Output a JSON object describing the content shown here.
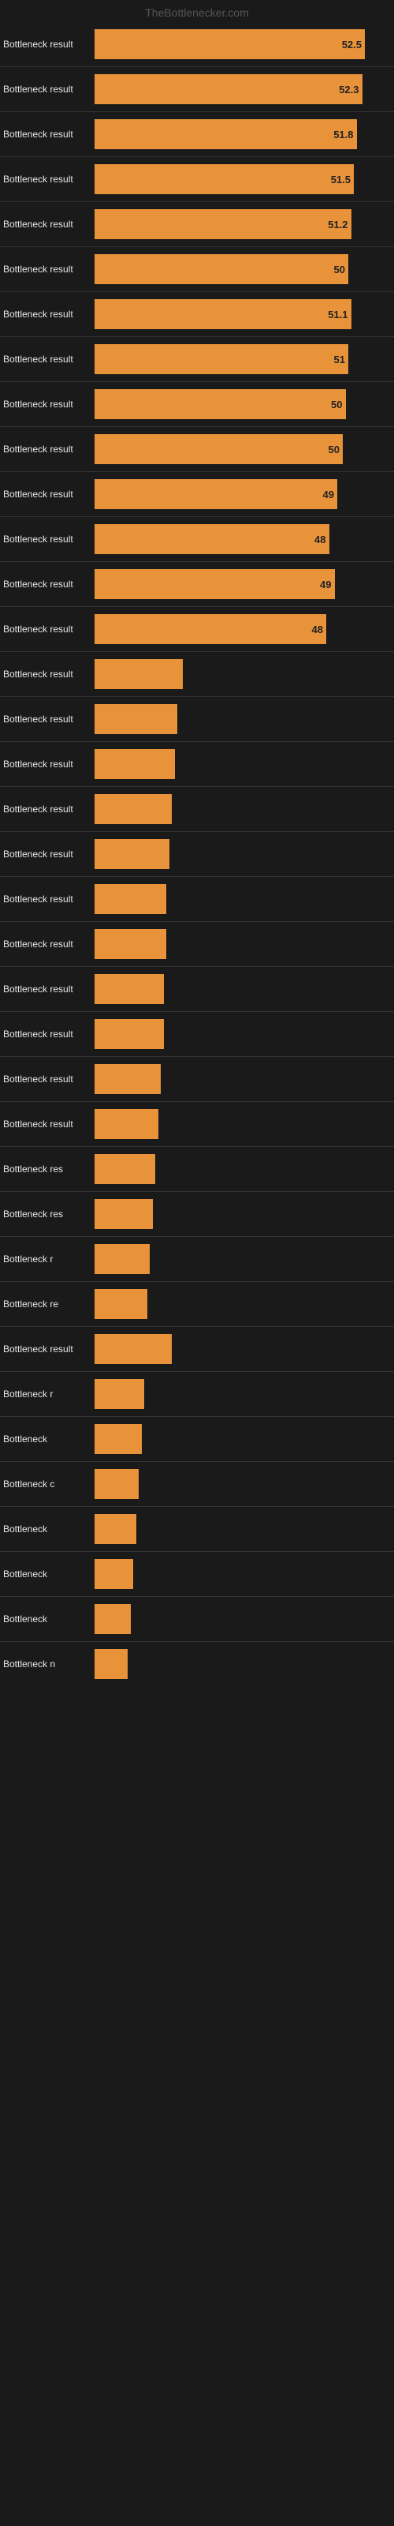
{
  "site_title": "TheBottlenecker.com",
  "bars": [
    {
      "label": "Bottleneck result",
      "value": 52.5,
      "display": "52.5",
      "width_pct": 98
    },
    {
      "label": "Bottleneck result",
      "value": 52.3,
      "display": "52.3",
      "width_pct": 97
    },
    {
      "label": "Bottleneck result",
      "value": 51.8,
      "display": "51.8",
      "width_pct": 95
    },
    {
      "label": "Bottleneck result",
      "value": 51.5,
      "display": "51.5",
      "width_pct": 94
    },
    {
      "label": "Bottleneck result",
      "value": 51.2,
      "display": "51.2",
      "width_pct": 93
    },
    {
      "label": "Bottleneck result",
      "value": 50.9,
      "display": "50",
      "width_pct": 92
    },
    {
      "label": "Bottleneck result",
      "value": 51.1,
      "display": "51.1",
      "width_pct": 93
    },
    {
      "label": "Bottleneck result",
      "value": 51.0,
      "display": "51",
      "width_pct": 92
    },
    {
      "label": "Bottleneck result",
      "value": 50.5,
      "display": "50",
      "width_pct": 91
    },
    {
      "label": "Bottleneck result",
      "value": 50.2,
      "display": "50",
      "width_pct": 90
    },
    {
      "label": "Bottleneck result",
      "value": 49.8,
      "display": "49",
      "width_pct": 88
    },
    {
      "label": "Bottleneck result",
      "value": 48.5,
      "display": "48",
      "width_pct": 85
    },
    {
      "label": "Bottleneck result",
      "value": 49.2,
      "display": "49",
      "width_pct": 87
    },
    {
      "label": "Bottleneck result",
      "value": 48.0,
      "display": "48",
      "width_pct": 84
    },
    {
      "label": "Bottleneck result",
      "value": null,
      "display": "",
      "width_pct": 32
    },
    {
      "label": "Bottleneck result",
      "value": null,
      "display": "",
      "width_pct": 30
    },
    {
      "label": "Bottleneck result",
      "value": null,
      "display": "",
      "width_pct": 29
    },
    {
      "label": "Bottleneck result",
      "value": null,
      "display": "",
      "width_pct": 28
    },
    {
      "label": "Bottleneck result",
      "value": null,
      "display": "",
      "width_pct": 27
    },
    {
      "label": "Bottleneck result",
      "value": null,
      "display": "",
      "width_pct": 26
    },
    {
      "label": "Bottleneck result",
      "value": null,
      "display": "",
      "width_pct": 26
    },
    {
      "label": "Bottleneck result",
      "value": null,
      "display": "",
      "width_pct": 25
    },
    {
      "label": "Bottleneck result",
      "value": null,
      "display": "",
      "width_pct": 25
    },
    {
      "label": "Bottleneck result",
      "value": null,
      "display": "",
      "width_pct": 24
    },
    {
      "label": "Bottleneck result",
      "value": null,
      "display": "",
      "width_pct": 23
    },
    {
      "label": "Bottleneck res",
      "value": null,
      "display": "",
      "width_pct": 22
    },
    {
      "label": "Bottleneck res",
      "value": null,
      "display": "",
      "width_pct": 21
    },
    {
      "label": "Bottleneck r",
      "value": null,
      "display": "",
      "width_pct": 20
    },
    {
      "label": "Bottleneck re",
      "value": null,
      "display": "",
      "width_pct": 19
    },
    {
      "label": "Bottleneck result",
      "value": null,
      "display": "",
      "width_pct": 28
    },
    {
      "label": "Bottleneck r",
      "value": null,
      "display": "",
      "width_pct": 18
    },
    {
      "label": "Bottleneck",
      "value": null,
      "display": "",
      "width_pct": 17
    },
    {
      "label": "Bottleneck c",
      "value": null,
      "display": "",
      "width_pct": 16
    },
    {
      "label": "Bottleneck",
      "value": null,
      "display": "",
      "width_pct": 15
    },
    {
      "label": "Bottleneck",
      "value": null,
      "display": "",
      "width_pct": 14
    },
    {
      "label": "Bottleneck",
      "value": null,
      "display": "",
      "width_pct": 13
    },
    {
      "label": "Bottleneck n",
      "value": null,
      "display": "",
      "width_pct": 12
    }
  ]
}
